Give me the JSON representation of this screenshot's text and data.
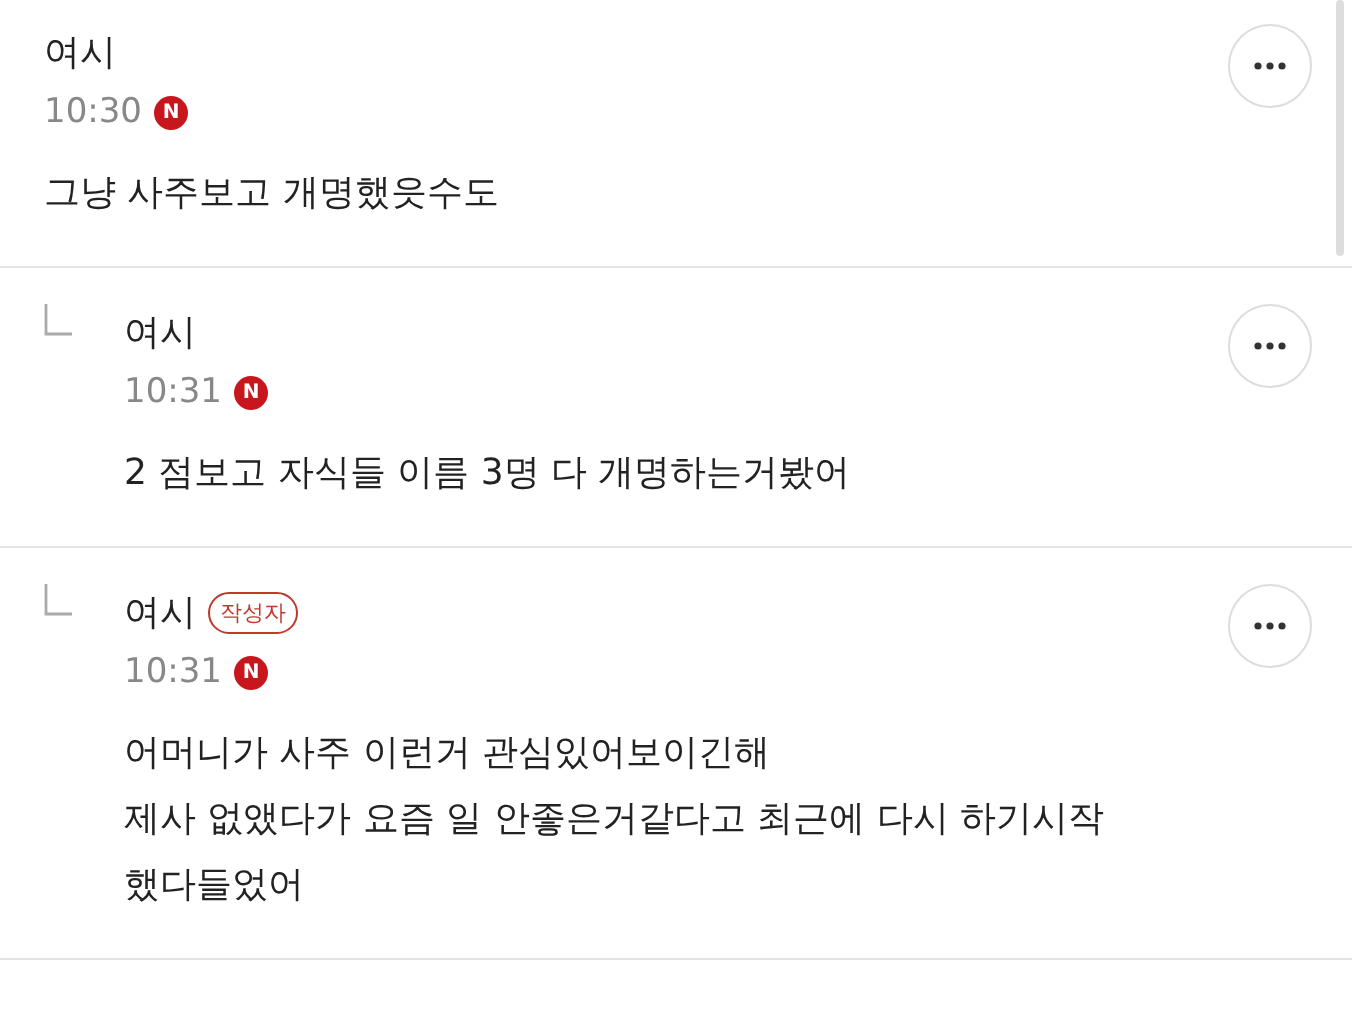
{
  "comments": [
    {
      "kind": "comment",
      "author": "여시",
      "time": "10:30",
      "badge": "N",
      "body": [
        "그냥 사주보고 개명했읏수도"
      ]
    },
    {
      "kind": "reply",
      "author": "여시",
      "time": "10:31",
      "badge": "N",
      "body": [
        "2 점보고 자식들 이름 3명 다 개명하는거봤어"
      ]
    },
    {
      "kind": "reply",
      "author": "여시",
      "author_tag": "작성자",
      "time": "10:31",
      "badge": "N",
      "body": [
        "어머니가 사주 이런거 관심있어보이긴해",
        "제사 없앴다가 요즘 일 안좋은거같다고 최근에 다시 하기시작",
        "했다들었어"
      ]
    }
  ]
}
